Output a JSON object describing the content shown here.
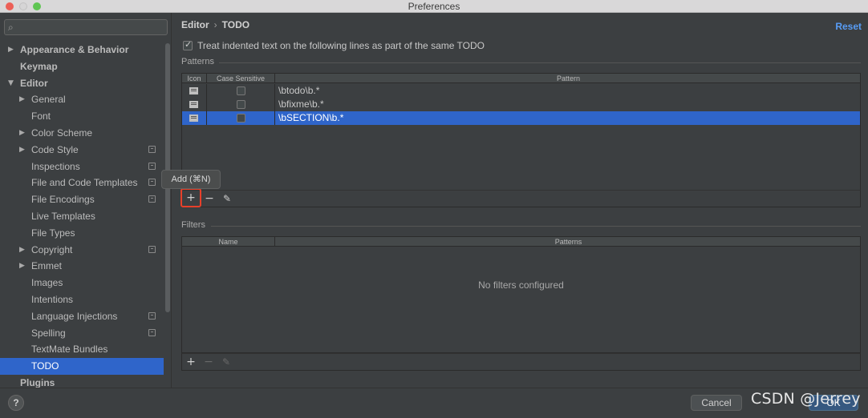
{
  "window": {
    "title": "Preferences"
  },
  "sidebar": {
    "search_placeholder": "",
    "items": [
      {
        "label": "Appearance & Behavior",
        "level": 0,
        "bold": true,
        "arrow": "▶"
      },
      {
        "label": "Keymap",
        "level": 0,
        "bold": true,
        "arrow": ""
      },
      {
        "label": "Editor",
        "level": 0,
        "bold": true,
        "arrow": "▼"
      },
      {
        "label": "General",
        "level": 1,
        "arrow": "▶"
      },
      {
        "label": "Font",
        "level": 1,
        "arrow": ""
      },
      {
        "label": "Color Scheme",
        "level": 1,
        "arrow": "▶"
      },
      {
        "label": "Code Style",
        "level": 1,
        "arrow": "▶",
        "project": true
      },
      {
        "label": "Inspections",
        "level": 1,
        "arrow": "",
        "project": true
      },
      {
        "label": "File and Code Templates",
        "level": 1,
        "arrow": "",
        "project": true
      },
      {
        "label": "File Encodings",
        "level": 1,
        "arrow": "",
        "project": true
      },
      {
        "label": "Live Templates",
        "level": 1,
        "arrow": ""
      },
      {
        "label": "File Types",
        "level": 1,
        "arrow": ""
      },
      {
        "label": "Copyright",
        "level": 1,
        "arrow": "▶",
        "project": true
      },
      {
        "label": "Emmet",
        "level": 1,
        "arrow": "▶"
      },
      {
        "label": "Images",
        "level": 1,
        "arrow": ""
      },
      {
        "label": "Intentions",
        "level": 1,
        "arrow": ""
      },
      {
        "label": "Language Injections",
        "level": 1,
        "arrow": "",
        "project": true
      },
      {
        "label": "Spelling",
        "level": 1,
        "arrow": "",
        "project": true
      },
      {
        "label": "TextMate Bundles",
        "level": 1,
        "arrow": ""
      },
      {
        "label": "TODO",
        "level": 1,
        "arrow": "",
        "selected": true
      },
      {
        "label": "Plugins",
        "level": 0,
        "bold": true,
        "arrow": ""
      }
    ]
  },
  "header": {
    "crumb1": "Editor",
    "sep": "›",
    "crumb2": "TODO",
    "reset": "Reset"
  },
  "options": {
    "indented_label": "Treat indented text on the following lines as part of the same TODO",
    "indented_checked": true
  },
  "patterns": {
    "title": "Patterns",
    "columns": {
      "icon": "Icon",
      "case": "Case Sensitive",
      "pattern": "Pattern"
    },
    "rows": [
      {
        "pattern": "\\btodo\\b.*",
        "case_sensitive": false,
        "selected": false
      },
      {
        "pattern": "\\bfixme\\b.*",
        "case_sensitive": false,
        "selected": false
      },
      {
        "pattern": "\\bSECTION\\b.*",
        "case_sensitive": false,
        "selected": true
      }
    ],
    "tooltip": "Add (⌘N)"
  },
  "filters": {
    "title": "Filters",
    "columns": {
      "name": "Name",
      "patterns": "Patterns"
    },
    "empty": "No filters configured"
  },
  "footer": {
    "help": "?",
    "cancel": "Cancel",
    "ok": "OK",
    "watermark": "CSDN @Jerrey"
  },
  "colors": {
    "accent": "#2f65ca",
    "link": "#589df6",
    "highlight": "#e8402a"
  },
  "icons": {
    "add": "plus-icon",
    "remove": "minus-icon",
    "edit": "pencil-icon"
  }
}
